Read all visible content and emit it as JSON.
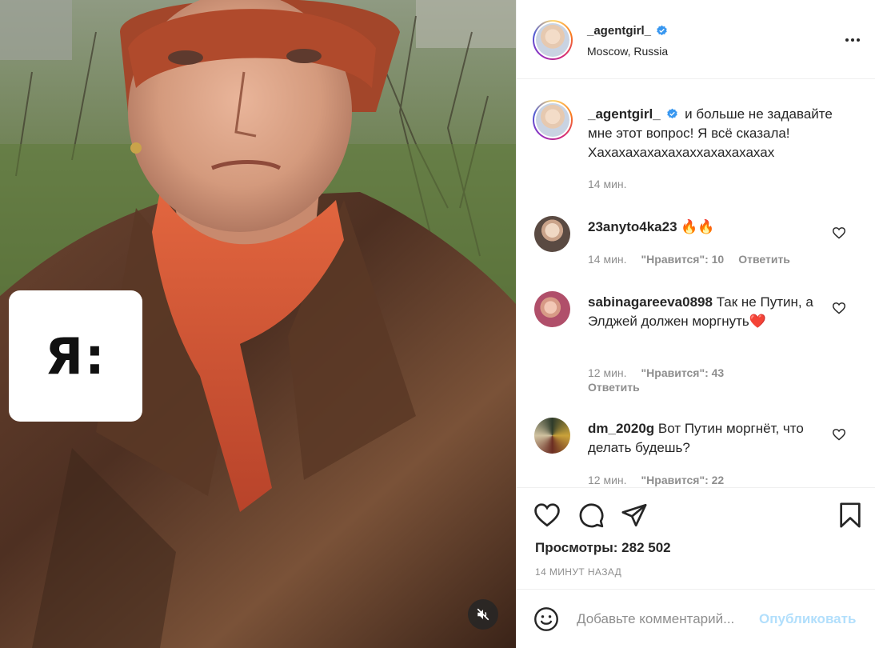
{
  "post": {
    "media_badge": "Я:",
    "mute_icon": "speaker-muted-icon"
  },
  "header": {
    "username": "_agentgirl_",
    "location": "Moscow, Russia",
    "verified_icon": "verified-badge-icon",
    "more_icon": "more-options-icon"
  },
  "caption": {
    "username": "_agentgirl_",
    "text": "и больше не задавайте мне этот вопрос! Я всё сказала! Хахахахахахахаххахахахахах",
    "time": "14 мин."
  },
  "comments": [
    {
      "username": "23anyto4ka23",
      "text": "🔥🔥",
      "time": "14 мин.",
      "likes": "\"Нравится\": 10",
      "reply": "Ответить"
    },
    {
      "username": "sabinagareeva0898",
      "text": "Так не Путин, а Элджей должен моргнуть❤️",
      "time": "12 мин.",
      "likes": "\"Нравится\": 43",
      "reply": "Ответить"
    },
    {
      "username": "dm_2020g",
      "text": "Вот Путин моргнёт, что делать будешь?",
      "time": "12 мин.",
      "likes": "\"Нравится\": 22"
    }
  ],
  "actions": {
    "like_icon": "heart-icon",
    "comment_icon": "comment-icon",
    "share_icon": "paper-plane-icon",
    "save_icon": "bookmark-icon",
    "views_label": "Просмотры:",
    "views_value": "282 502",
    "posted": "14 минут назад"
  },
  "add_comment": {
    "emoji_icon": "smiley-icon",
    "placeholder": "Добавьте комментарий...",
    "publish_label": "Опубликовать"
  },
  "colors": {
    "link_disabled": "#b2dffc",
    "verified": "#3897f0",
    "muted_text": "#8e8e8e",
    "like_red": "#ed4956"
  }
}
